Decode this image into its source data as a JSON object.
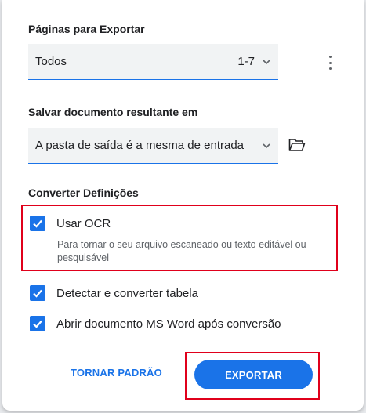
{
  "pages_section": {
    "label": "Páginas para Exportar",
    "select_value": "Todos",
    "range": "1-7"
  },
  "save_section": {
    "label": "Salvar documento resultante em",
    "select_value": "A pasta de saída é a mesma de entrada"
  },
  "settings_section": {
    "label": "Converter Definições",
    "ocr": {
      "label": "Usar OCR",
      "checked": true,
      "description": "Para tornar o seu arquivo escaneado ou texto editável ou pesquisável"
    },
    "detect_tables": {
      "label": "Detectar e converter tabela",
      "checked": true
    },
    "open_word": {
      "label": "Abrir documento MS Word após conversão",
      "checked": true
    }
  },
  "buttons": {
    "reset_label": "TORNAR PADRÃO",
    "export_label": "EXPORTAR"
  },
  "colors": {
    "accent": "#1a73e8",
    "highlight": "#e0001b"
  },
  "icons": {
    "more": "more-vert-icon",
    "folder": "folder-open-icon",
    "chevron": "chevron-down-icon",
    "check": "checkmark-icon"
  }
}
